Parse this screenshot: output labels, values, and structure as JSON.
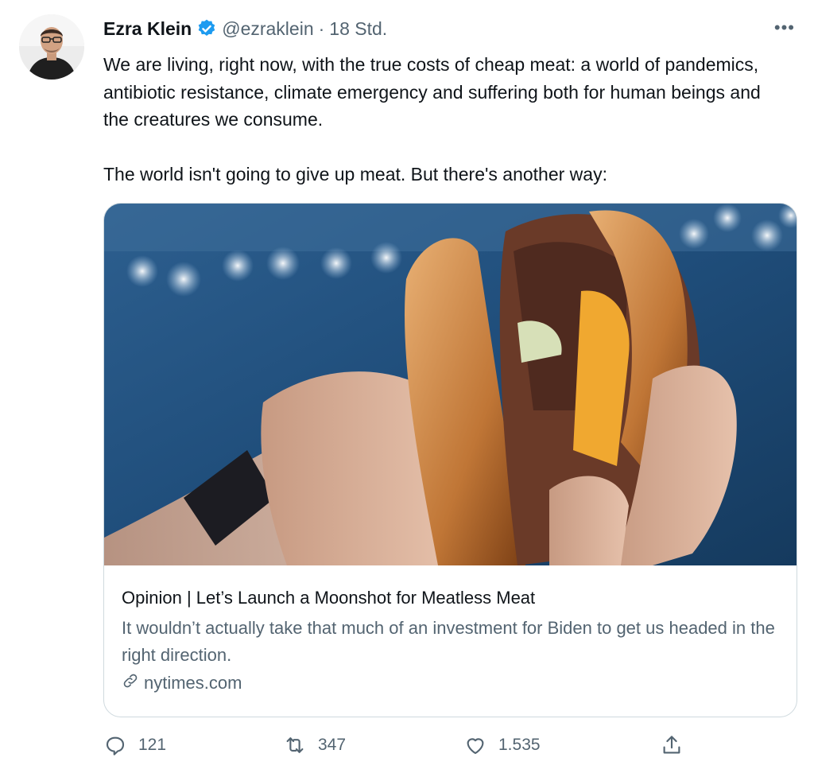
{
  "tweet": {
    "author_name": "Ezra Klein",
    "handle": "@ezraklein",
    "separator": "·",
    "time": "18 Std.",
    "more_label": "•••",
    "paragraphs": [
      "We are living, right now, with the true costs of cheap meat: a world of pandemics, antibiotic resistance, climate emergency and suffering both for human beings and the creatures we consume.",
      "The world isn't going to give up meat. But there's another way:"
    ]
  },
  "card": {
    "image_icon": "burger-photo",
    "title": "Opinion | Let’s Launch a Moonshot for Meatless Meat",
    "description": "It wouldn’t actually take that much of an investment for Biden to get us headed in the right direction.",
    "domain": "nytimes.com"
  },
  "actions": {
    "reply_count": "121",
    "retweet_count": "347",
    "like_count": "1.535"
  },
  "icons": [
    "verified-badge-icon",
    "more-icon",
    "link-icon",
    "reply-icon",
    "retweet-icon",
    "like-icon",
    "share-icon"
  ],
  "colors": {
    "verified": "#1d9bf0",
    "secondary_text": "#536471",
    "card_border": "#cfd9de"
  }
}
